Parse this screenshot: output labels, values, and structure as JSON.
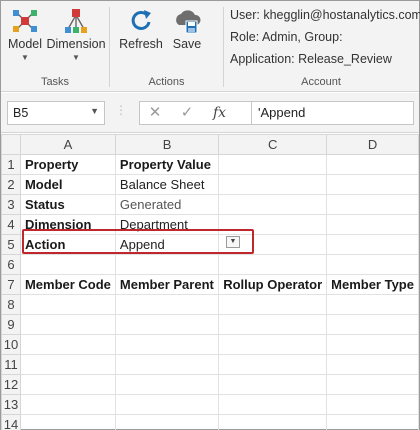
{
  "ribbon": {
    "tasks": {
      "label": "Tasks",
      "model_label": "Model",
      "dimension_label": "Dimension"
    },
    "actions": {
      "label": "Actions",
      "refresh_label": "Refresh",
      "save_label": "Save"
    },
    "account": {
      "label": "Account",
      "user_line": "User: khegglin@hostanalytics.com",
      "role_line": "Role: Admin, Group:",
      "application_line": "Application: Release_Review"
    }
  },
  "formula_bar": {
    "name_box": "B5",
    "fx_symbol": "fx",
    "formula": "'Append"
  },
  "grid": {
    "columns": [
      "A",
      "B",
      "C",
      "D"
    ],
    "rows": [
      {
        "num": "1",
        "a": "Property",
        "b": "Property Value",
        "c": "",
        "d": ""
      },
      {
        "num": "2",
        "a": "Model",
        "b": "Balance Sheet",
        "c": "",
        "d": ""
      },
      {
        "num": "3",
        "a": "Status",
        "b": "Generated",
        "c": "",
        "d": ""
      },
      {
        "num": "4",
        "a": "Dimension",
        "b": "Department",
        "c": "",
        "d": ""
      },
      {
        "num": "5",
        "a": "Action",
        "b": "Append",
        "c": "",
        "d": ""
      },
      {
        "num": "6",
        "a": "",
        "b": "",
        "c": "",
        "d": ""
      },
      {
        "num": "7",
        "a": "Member Code",
        "b": "Member Parent",
        "c": "Rollup Operator",
        "d": "Member Type"
      },
      {
        "num": "8",
        "a": "",
        "b": "",
        "c": "",
        "d": ""
      },
      {
        "num": "9",
        "a": "",
        "b": "",
        "c": "",
        "d": ""
      },
      {
        "num": "10",
        "a": "",
        "b": "",
        "c": "",
        "d": ""
      },
      {
        "num": "11",
        "a": "",
        "b": "",
        "c": "",
        "d": ""
      },
      {
        "num": "12",
        "a": "",
        "b": "",
        "c": "",
        "d": ""
      },
      {
        "num": "13",
        "a": "",
        "b": "",
        "c": "",
        "d": ""
      },
      {
        "num": "14",
        "a": "",
        "b": "",
        "c": "",
        "d": ""
      }
    ]
  },
  "colors": {
    "highlight": "#c0272d",
    "refresh_icon": "#1f6fb5",
    "ribbon_bg": "#f3f3f3"
  }
}
